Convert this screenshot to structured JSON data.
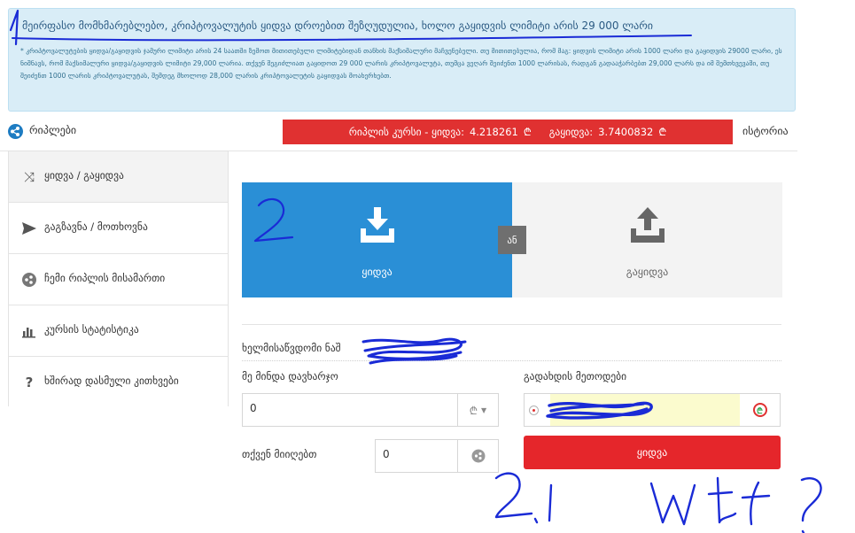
{
  "notice": {
    "title": "მეირფასო მომხმარებლებო, კრიპტოვალუტის ყიდვა დროებით შეზღუდულია, ხოლო გაყიდვის ლიმიტი არის 29 000 ლარი",
    "body": "* კრიპტოვალუტების ყიდვა/გაყიდვის ჯამური ლიმიტი არის 24 საათში ზემოთ მითითებული ლიმიტებიდან თანხის მაქსიმალური მაჩვენებელი. თუ მითითებულია, რომ მაგ: ყიდვის ლიმიტი არის 1000 ლარი და გაყიდვის 29000 ლარი, ეს ნიშნავს, რომ მაქსიმალური ყიდვა/გაყიდვის ლიმიტი 29,000 ლარია. თქვენ შეგიძლიათ გაყიდოთ 29 000 ლარის კრიპტოვალუტა, თუმცა ვეღარ შეიძენთ 1000 ლარისას, რადგან გადააჭარბებთ 29,000 ლარს და იმ შემთხვევაში, თუ შეიძენთ 1000 ლარის კრიპტოვალუტას, შემდეგ მხოლოდ 28,000 ლარის კრიპტოვალუტის გაყიდვას მოახერხებთ."
  },
  "coin": {
    "name": "რიპლები",
    "icon": "ripple-icon",
    "rate_prefix": "რიპლის კურსი - ყიდვა:",
    "buy_rate": "4.218261",
    "sell_prefix": "გაყიდვა:",
    "sell_rate": "3.7400832",
    "currency_symbol": "₾",
    "history": "ისტორია"
  },
  "sidebar": {
    "items": [
      {
        "label": "ყიდვა / გაყიდვა",
        "icon": "shuffle-icon"
      },
      {
        "label": "გაგზავნა / მოთხოვნა",
        "icon": "send-icon"
      },
      {
        "label": "ჩემი რიპლის მისამართი",
        "icon": "ripple-icon"
      },
      {
        "label": "კურსის სტატისტიკა",
        "icon": "bar-chart-icon"
      },
      {
        "label": "ხშირად დასმული კითხვები",
        "icon": "question-icon"
      }
    ]
  },
  "trade": {
    "buy_label": "ყიდვა",
    "sell_label": "გაყიდვა",
    "or_label": "ან",
    "available_label": "ხელმისაწვდომი ნაშ",
    "spend_label": "მე მინდა დავხარჯო",
    "spend_value": "0",
    "receive_label": "თქვენ მიიღებთ",
    "receive_value": "0",
    "payment_label": "გადახდის მეთოდები",
    "submit_label": "ყიდვა"
  },
  "colors": {
    "accent_blue": "#2a8fd6",
    "danger_red": "#e03131",
    "notice_bg": "#d9edf7",
    "annotation_ink": "#1a2bd6"
  },
  "annotations": {
    "mark_1": "1",
    "mark_2": "2",
    "mark_3": "2,1 wtf?"
  }
}
